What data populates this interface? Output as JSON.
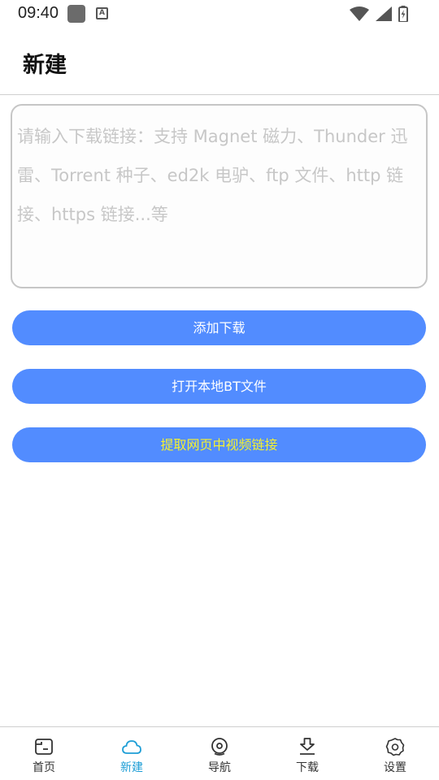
{
  "status_bar": {
    "time": "09:40",
    "app_icon_letter": "A"
  },
  "header": {
    "title": "新建"
  },
  "link_input": {
    "value": "",
    "placeholder": "请输入下载链接：支持 Magnet 磁力、Thunder 迅雷、Torrent 种子、ed2k 电驴、ftp 文件、http 链接、https 链接...等"
  },
  "buttons": {
    "add_download": "添加下载",
    "open_local_bt": "打开本地BT文件",
    "extract_video": "提取网页中视频链接"
  },
  "colors": {
    "primary_button": "#528cff",
    "button_text": "#ffffff",
    "highlight_text": "#f5f12c",
    "nav_active": "#1e9ed6"
  },
  "bottom_nav": {
    "active": "新建",
    "items": [
      {
        "label": "首页",
        "icon": "home-icon"
      },
      {
        "label": "新建",
        "icon": "cloud-icon"
      },
      {
        "label": "导航",
        "icon": "compass-icon"
      },
      {
        "label": "下载",
        "icon": "download-icon"
      },
      {
        "label": "设置",
        "icon": "gear-icon"
      }
    ]
  }
}
